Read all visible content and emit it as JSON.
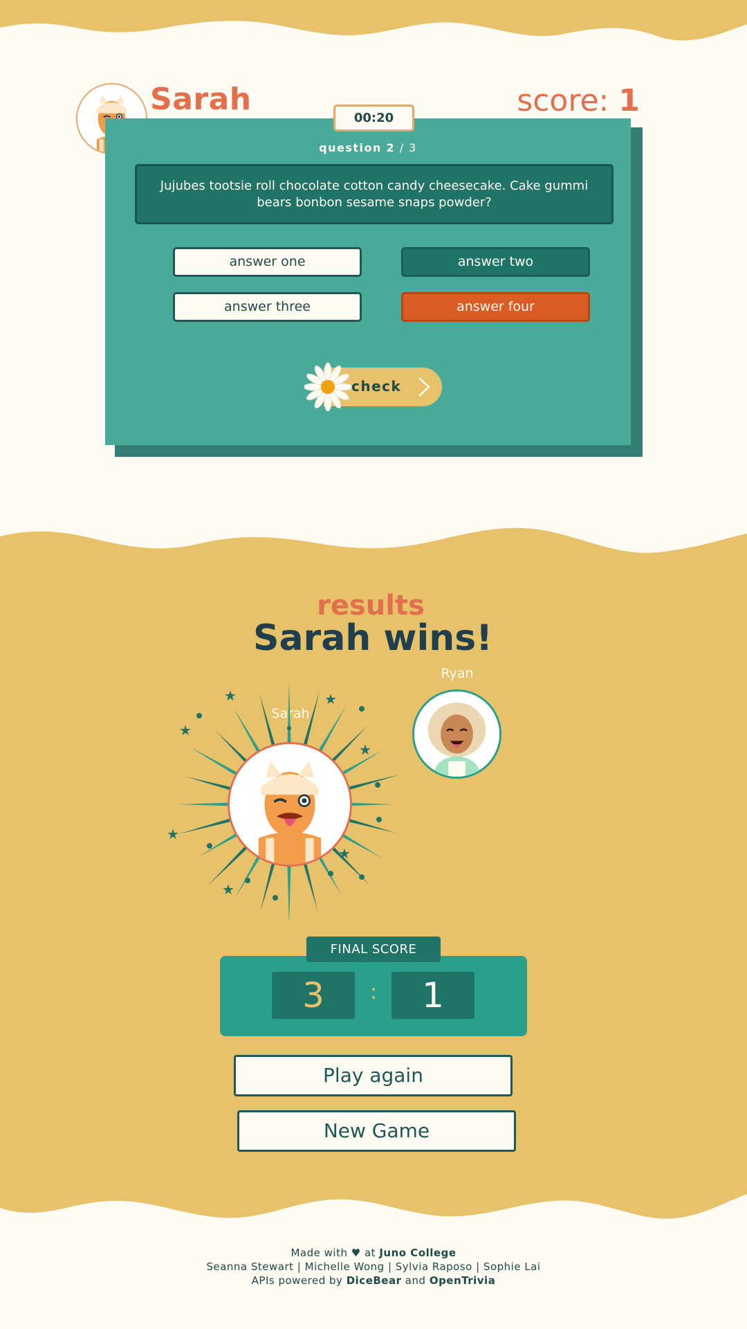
{
  "player": {
    "name": "Sarah",
    "score_label": "score:",
    "score_value": "1"
  },
  "quiz": {
    "timer": "00:20",
    "question_word": "question",
    "current": "2",
    "separator": "/",
    "total": "3",
    "question": "Jujubes tootsie roll chocolate cotton candy cheesecake. Cake gummi bears bonbon sesame snaps powder?",
    "answers": [
      {
        "label": "answer one",
        "state": "default"
      },
      {
        "label": "answer two",
        "state": "selected"
      },
      {
        "label": "answer three",
        "state": "default"
      },
      {
        "label": "answer four",
        "state": "highlighted"
      }
    ],
    "check_label": "check"
  },
  "results": {
    "heading": "results",
    "winner_text": "Sarah wins!",
    "winner_name": "Sarah",
    "runner_up_name": "Ryan",
    "final_score_label": "FINAL SCORE",
    "score_left": "3",
    "score_sep": ":",
    "score_right": "1",
    "play_again": "Play again",
    "new_game": "New Game"
  },
  "footer": {
    "made_with": "Made with",
    "heart": "♥",
    "at": "at",
    "juno": "Juno College",
    "credits": "Seanna Stewart | Michelle Wong | Sylvia Raposo | Sophie Lai",
    "apis": "APIs powered by",
    "dicebear": "DiceBear",
    "and": "and",
    "opentrivia": "OpenTrivia"
  },
  "colors": {
    "accent": "#e36f4c",
    "teal": "#49aa99",
    "dark_teal": "#1f7367",
    "mustard": "#e8c26a",
    "cream": "#fdfbf2",
    "orange": "#d85c23"
  }
}
